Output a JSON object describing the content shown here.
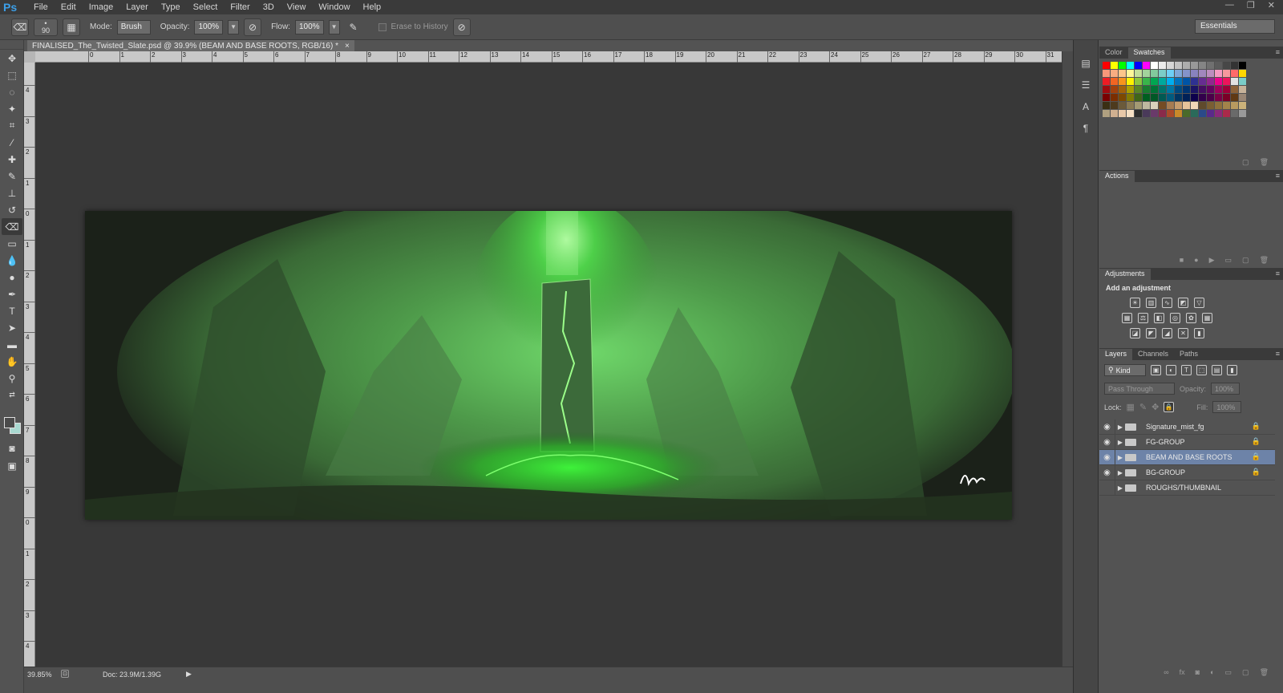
{
  "app": {
    "logo": "Ps",
    "menu": [
      "File",
      "Edit",
      "Image",
      "Layer",
      "Type",
      "Select",
      "Filter",
      "3D",
      "View",
      "Window",
      "Help"
    ],
    "window_controls": [
      "—",
      "❐",
      "✕"
    ]
  },
  "options_bar": {
    "brush_size": "90",
    "mode_label": "Mode:",
    "mode_value": "Brush",
    "opacity_label": "Opacity:",
    "opacity_value": "100%",
    "flow_label": "Flow:",
    "flow_value": "100%",
    "erase_history_label": "Erase to History",
    "workspace": "Essentials"
  },
  "document": {
    "tab_title": "FINALISED_The_Twisted_Slate.psd @ 39.9% (BEAM AND BASE ROOTS, RGB/16) *",
    "close": "×",
    "ruler_h": [
      "0",
      "1",
      "2",
      "3",
      "4",
      "5",
      "6",
      "7",
      "8",
      "9",
      "10",
      "11",
      "12",
      "13",
      "14",
      "15",
      "16",
      "17",
      "18",
      "19",
      "20",
      "21",
      "22",
      "23",
      "24",
      "25",
      "26",
      "27",
      "28",
      "29",
      "30",
      "31"
    ],
    "ruler_v": [
      "4",
      "3",
      "2",
      "1",
      "0",
      "1",
      "2",
      "3",
      "4",
      "5",
      "6",
      "7",
      "8",
      "9",
      "0",
      "1",
      "2",
      "3",
      "4"
    ],
    "signature": "Lum ."
  },
  "status": {
    "zoom": "39.85%",
    "doc_size": "Doc: 23.9M/1.39G"
  },
  "panels": {
    "color_tabs": [
      "Color",
      "Swatches"
    ],
    "swatch_colors": [
      "#ff0000",
      "#ffff00",
      "#00ff00",
      "#00ffff",
      "#0000ff",
      "#ff00ff",
      "#ffffff",
      "#ebebeb",
      "#d6d6d6",
      "#c2c2c2",
      "#adadad",
      "#999999",
      "#858585",
      "#707070",
      "#5c5c5c",
      "#474747",
      "#333333",
      "#000000",
      "#f7977a",
      "#f9ad81",
      "#fdc68a",
      "#fff79a",
      "#c4df9b",
      "#a3d39c",
      "#82ca9d",
      "#7bcdc8",
      "#6ecff6",
      "#7ea7d8",
      "#8493ca",
      "#8882be",
      "#a187be",
      "#bc8dbf",
      "#f49ac2",
      "#f6989d",
      "#ff6a6a",
      "#ffd700",
      "#ed1c24",
      "#f26522",
      "#f7941d",
      "#fff200",
      "#8dc63f",
      "#39b54a",
      "#00a651",
      "#00a99d",
      "#00aeef",
      "#0072bc",
      "#0054a6",
      "#2e3192",
      "#662d91",
      "#92278f",
      "#ec008c",
      "#ed145b",
      "#e2e2e2",
      "#7accc8",
      "#9e0b0f",
      "#a0410d",
      "#a3620a",
      "#aba000",
      "#598527",
      "#197b30",
      "#007236",
      "#00746b",
      "#0076a3",
      "#004a80",
      "#003471",
      "#1b1464",
      "#440e62",
      "#630460",
      "#9e005d",
      "#9e0039",
      "#8c6239",
      "#c7b299",
      "#790000",
      "#7b2e00",
      "#7d4900",
      "#827b00",
      "#406618",
      "#005e20",
      "#005826",
      "#005952",
      "#005b7f",
      "#003663",
      "#002157",
      "#0d004c",
      "#32004b",
      "#4b0049",
      "#7b0046",
      "#7a0026",
      "#603913",
      "#998675",
      "#3a2f14",
      "#4d3a1d",
      "#6b5a3a",
      "#8a7a54",
      "#a39a74",
      "#beb8a0",
      "#d9d1bc",
      "#754c24",
      "#a67c52",
      "#c69c6d",
      "#e6c39a",
      "#f0d8b8",
      "#5f4a2c",
      "#7a5e33",
      "#8f703c",
      "#a3834a",
      "#b89a5f",
      "#cbb27a",
      "#b0a080",
      "#d0b090",
      "#e8c8a8",
      "#f5dfc4",
      "#2d2d2d",
      "#4a3a5a",
      "#6a3a6a",
      "#8a2a4a",
      "#aa4a2a",
      "#ca8a2a",
      "#4a6a2a",
      "#2a6a5a",
      "#2a4a8a",
      "#5a2a8a",
      "#8a2a7a",
      "#aa2a4a",
      "#6a6a6a",
      "#9a9a9a"
    ],
    "actions_tab": "Actions",
    "adjustments_tab": "Adjustments",
    "add_adjustment": "Add an adjustment",
    "layers_tabs": [
      "Layers",
      "Channels",
      "Paths"
    ],
    "kind_label": "Kind",
    "blend_mode": "Pass Through",
    "opacity_label": "Opacity:",
    "opacity_value": "100%",
    "lock_label": "Lock:",
    "fill_label": "Fill:",
    "fill_value": "100%",
    "layers": [
      {
        "name": "Signature_mist_fg",
        "visible": true,
        "selected": false
      },
      {
        "name": "FG-GROUP",
        "visible": true,
        "selected": false
      },
      {
        "name": "BEAM AND BASE ROOTS",
        "visible": true,
        "selected": true
      },
      {
        "name": "BG-GROUP",
        "visible": true,
        "selected": false
      },
      {
        "name": "ROUGHS/THUMBNAIL",
        "visible": false,
        "selected": false
      }
    ]
  }
}
